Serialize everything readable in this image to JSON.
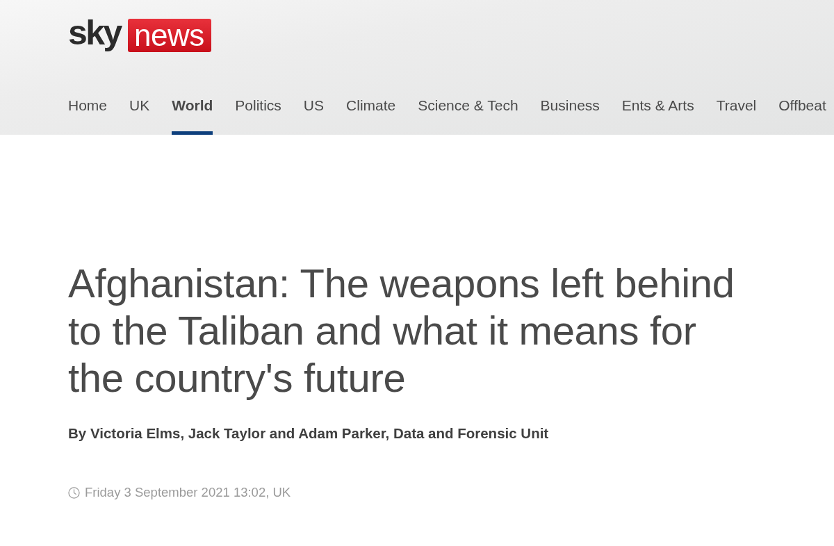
{
  "logo": {
    "wordmark": "sky",
    "badge": "news"
  },
  "nav": [
    {
      "label": "Home",
      "selected": false
    },
    {
      "label": "UK",
      "selected": false
    },
    {
      "label": "World",
      "selected": true
    },
    {
      "label": "Politics",
      "selected": false
    },
    {
      "label": "US",
      "selected": false
    },
    {
      "label": "Climate",
      "selected": false
    },
    {
      "label": "Science & Tech",
      "selected": false
    },
    {
      "label": "Business",
      "selected": false
    },
    {
      "label": "Ents & Arts",
      "selected": false
    },
    {
      "label": "Travel",
      "selected": false
    },
    {
      "label": "Offbeat",
      "selected": false
    }
  ],
  "article": {
    "headline": "Afghanistan: The weapons left behind to the Taliban and what it means for the country's future",
    "byline": "By Victoria Elms, Jack Taylor and Adam Parker, Data and Forensic Unit",
    "date": "Friday 3 September 2021 13:02, UK"
  }
}
